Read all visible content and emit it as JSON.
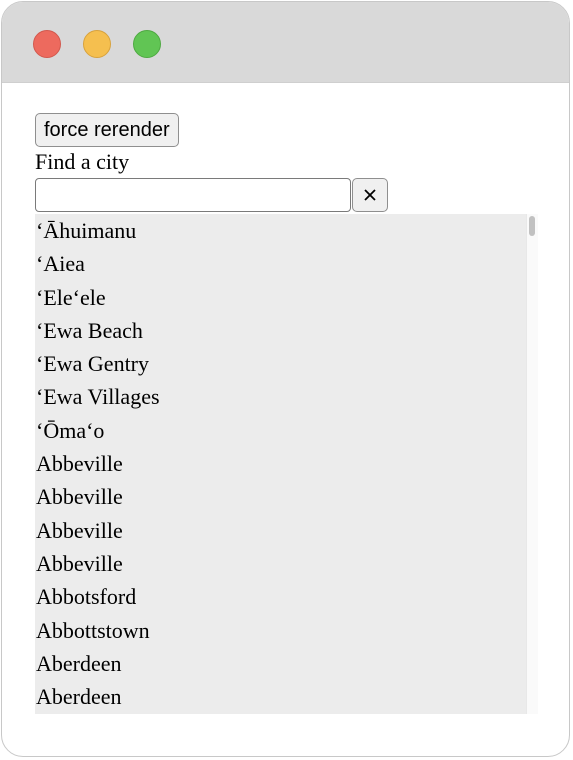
{
  "window": {
    "controls": [
      "close-button",
      "minimize-button",
      "maximize-button"
    ],
    "colors": {
      "close": "#ed6a5e",
      "minimize": "#f5bf4f",
      "maximize": "#61c554"
    }
  },
  "toolbar": {
    "rerender_label": "force rerender"
  },
  "search": {
    "label": "Find a city",
    "value": "",
    "placeholder": "",
    "clear_icon": "close-icon"
  },
  "cities": [
    "‘Āhuimanu",
    "‘Aiea",
    "‘Ele‘ele",
    "‘Ewa Beach",
    "‘Ewa Gentry",
    "‘Ewa Villages",
    "‘Ōma‘o",
    "Abbeville",
    "Abbeville",
    "Abbeville",
    "Abbeville",
    "Abbotsford",
    "Abbottstown",
    "Aberdeen",
    "Aberdeen"
  ]
}
